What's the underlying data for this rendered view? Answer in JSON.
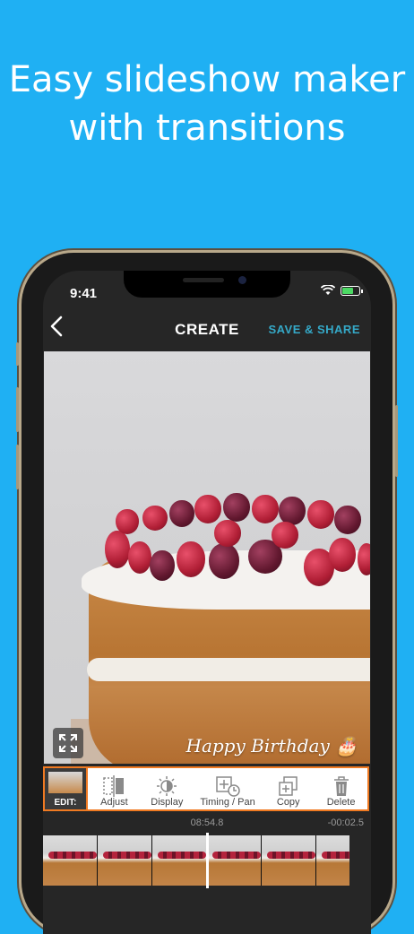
{
  "headline": {
    "line1": "Easy slideshow maker",
    "line2": "with transitions"
  },
  "status_bar": {
    "time": "9:41"
  },
  "nav": {
    "back_icon": "chevron-left-icon",
    "title": "CREATE",
    "save_label": "SAVE & SHARE"
  },
  "photo": {
    "caption": "Happy Birthday 🎂"
  },
  "toolbar": {
    "edit_label": "EDIT:",
    "tools": [
      {
        "label": "Adjust",
        "icon": "adjust-icon"
      },
      {
        "label": "Display",
        "icon": "display-icon"
      },
      {
        "label": "Timing / Pan",
        "icon": "timing-pan-icon"
      },
      {
        "label": "Copy",
        "icon": "copy-icon"
      },
      {
        "label": "Delete",
        "icon": "trash-icon"
      }
    ]
  },
  "timeline": {
    "current_time": "08:54.8",
    "remaining_time": "-00:02.5"
  },
  "colors": {
    "background": "#1fb0f3",
    "accent": "#f07a22",
    "save_color": "#35a9c8"
  }
}
